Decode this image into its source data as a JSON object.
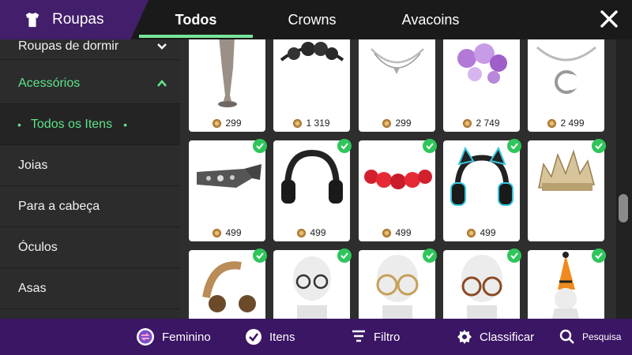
{
  "header": {
    "brand_icon": "shirt-icon",
    "title": "Roupas",
    "tabs": [
      {
        "label": "Todos",
        "active": true
      },
      {
        "label": "Crowns",
        "active": false
      },
      {
        "label": "Avacoins",
        "active": false
      }
    ],
    "close_icon": "close-icon"
  },
  "sidebar": {
    "items": [
      {
        "label": "Roupas de dormir"
      },
      {
        "label": "Acessórios"
      },
      {
        "label": "Todos os Itens"
      },
      {
        "label": "Joias"
      },
      {
        "label": "Para a cabeça"
      },
      {
        "label": "Óculos"
      },
      {
        "label": "Asas"
      }
    ]
  },
  "grid": {
    "rows": [
      [
        {
          "price": "299",
          "owned": false,
          "icon": "mannequin-legs-icon"
        },
        {
          "price": "1 319",
          "owned": false,
          "icon": "black-flower-headband-icon"
        },
        {
          "price": "299",
          "owned": false,
          "icon": "silver-necklace-icon"
        },
        {
          "price": "2 749",
          "owned": false,
          "icon": "purple-flower-crown-icon"
        },
        {
          "price": "2 499",
          "owned": false,
          "icon": "moon-choker-icon"
        }
      ],
      [
        {
          "price": "499",
          "owned": true,
          "icon": "studded-headband-icon"
        },
        {
          "price": "499",
          "owned": true,
          "icon": "black-headphones-icon"
        },
        {
          "price": "499",
          "owned": true,
          "icon": "red-rose-crown-icon"
        },
        {
          "price": "499",
          "owned": true,
          "icon": "cat-ear-headphones-icon"
        },
        {
          "price": "",
          "owned": true,
          "icon": "spiked-crown-icon"
        }
      ],
      [
        {
          "price": "",
          "owned": true,
          "icon": "leopard-headphones-icon"
        },
        {
          "price": "",
          "owned": true,
          "icon": "round-glasses-icon"
        },
        {
          "price": "",
          "owned": true,
          "icon": "gold-glasses-icon"
        },
        {
          "price": "",
          "owned": true,
          "icon": "tortoise-glasses-icon"
        },
        {
          "price": "",
          "owned": true,
          "icon": "party-hat-icon"
        }
      ]
    ]
  },
  "bottom_bar": {
    "items": [
      {
        "label": "Feminino",
        "icon": "gender-swap-icon"
      },
      {
        "label": "Itens",
        "icon": "check-circle-icon"
      },
      {
        "label": "Filtro",
        "icon": "filter-icon"
      },
      {
        "label": "Classificar",
        "icon": "sort-badge-icon"
      },
      {
        "label": "Pesquisa",
        "icon": "search-icon"
      }
    ]
  },
  "colors": {
    "accent_green": "#5ee18a",
    "brand_purple": "#421e6b",
    "bottom_purple": "#3a1664",
    "coin": "#c28b3c"
  }
}
